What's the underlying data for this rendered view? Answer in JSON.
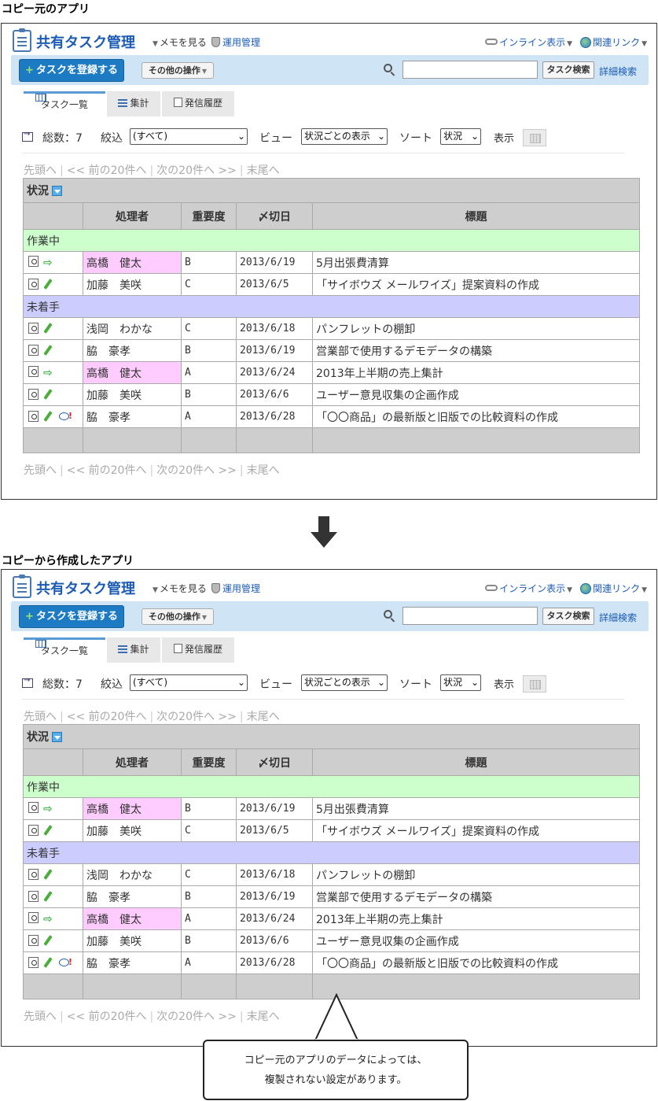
{
  "captions": {
    "top": "コピー元のアプリ",
    "bottom": "コピーから作成したアプリ"
  },
  "app": {
    "title": "共有タスク管理",
    "memo": "メモを見る",
    "unyo": "運用管理",
    "inline": "インライン表示",
    "links": "関連リンク"
  },
  "toolbar": {
    "register": "タスクを登録する",
    "other": "その他の操作",
    "search_value": "",
    "task_search": "タスク検索",
    "adv_search": "詳細検索"
  },
  "tabs": [
    "タスク一覧",
    "集計",
    "発信履歴"
  ],
  "summary": {
    "total": "総数：7",
    "filter_label": "絞込",
    "filter_value": "(すべて)",
    "view_label": "ビュー",
    "view_value": "状況ごとの表示",
    "sort_label": "ソート",
    "sort_value": "状況",
    "display_label": "表示"
  },
  "pager": {
    "first": "先頭へ",
    "prev": "<< 前の20件へ",
    "next": "次の20件へ >>",
    "last": "末尾へ"
  },
  "grid": {
    "status_header": "状況",
    "columns": [
      "処理者",
      "重要度",
      "〆切日",
      "標題"
    ],
    "groups": [
      {
        "name": "作業中",
        "rows": [
          {
            "icons": "arrow",
            "assignee": "高橋　健太",
            "priority": "B",
            "due": "2013/6/19",
            "title": "5月出張費清算",
            "highlight": true
          },
          {
            "icons": "pencil",
            "assignee": "加藤　美咲",
            "priority": "C",
            "due": "2013/6/5",
            "title": "「サイボウズ メールワイズ」提案資料の作成",
            "highlight": false
          }
        ]
      },
      {
        "name": "未着手",
        "rows": [
          {
            "icons": "pencil",
            "assignee": "浅岡　わかな",
            "priority": "C",
            "due": "2013/6/18",
            "title": "パンフレットの棚卸",
            "highlight": false
          },
          {
            "icons": "pencil",
            "assignee": "脇　豪孝",
            "priority": "B",
            "due": "2013/6/19",
            "title": "営業部で使用するデモデータの構築",
            "highlight": false
          },
          {
            "icons": "arrow",
            "assignee": "高橋　健太",
            "priority": "A",
            "due": "2013/6/24",
            "title": "2013年上半期の売上集計",
            "highlight": true
          },
          {
            "icons": "pencil",
            "assignee": "加藤　美咲",
            "priority": "B",
            "due": "2013/6/6",
            "title": "ユーザー意見収集の企画作成",
            "highlight": false
          },
          {
            "icons": "pencil-bubble",
            "assignee": "脇　豪孝",
            "priority": "A",
            "due": "2013/6/28",
            "title": "「〇〇商品」の最新版と旧版での比較資料の作成",
            "highlight": false
          }
        ]
      }
    ]
  },
  "callout": {
    "line1": "コピー元のアプリのデータによっては、",
    "line2": "複製されない設定があります。"
  },
  "colors": {
    "accent": "#1b5bb5",
    "toolbar_bg": "#cfe4f5",
    "group_in_progress": "#ccffcc",
    "group_not_started": "#ccccff",
    "highlight": "#ffccff"
  }
}
